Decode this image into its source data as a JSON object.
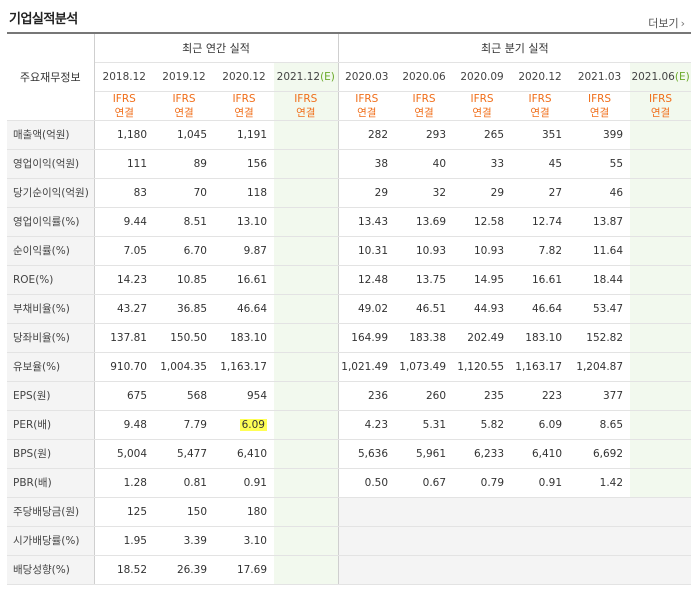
{
  "title": "기업실적분석",
  "more_label": "더보기",
  "header": {
    "row_label": "주요재무정보",
    "annual_group": "최근 연간 실적",
    "quarter_group": "최근 분기 실적"
  },
  "annual_periods": [
    {
      "label": "2018.12",
      "mark": "",
      "std1": "IFRS",
      "std2": "연결"
    },
    {
      "label": "2019.12",
      "mark": "",
      "std1": "IFRS",
      "std2": "연결"
    },
    {
      "label": "2020.12",
      "mark": "",
      "std1": "IFRS",
      "std2": "연결"
    },
    {
      "label": "2021.12",
      "mark": "(E)",
      "std1": "IFRS",
      "std2": "연결"
    }
  ],
  "quarter_periods": [
    {
      "label": "2020.03",
      "mark": "",
      "std1": "IFRS",
      "std2": "연결"
    },
    {
      "label": "2020.06",
      "mark": "",
      "std1": "IFRS",
      "std2": "연결"
    },
    {
      "label": "2020.09",
      "mark": "",
      "std1": "IFRS",
      "std2": "연결"
    },
    {
      "label": "2020.12",
      "mark": "",
      "std1": "IFRS",
      "std2": "연결"
    },
    {
      "label": "2021.03",
      "mark": "",
      "std1": "IFRS",
      "std2": "연결"
    },
    {
      "label": "2021.06",
      "mark": "(E)",
      "std1": "IFRS",
      "std2": "연결"
    }
  ],
  "rows": [
    {
      "label": "매출액(억원)",
      "annual": [
        "1,180",
        "1,045",
        "1,191",
        ""
      ],
      "quarter": [
        "282",
        "293",
        "265",
        "351",
        "399",
        ""
      ]
    },
    {
      "label": "영업이익(억원)",
      "annual": [
        "111",
        "89",
        "156",
        ""
      ],
      "quarter": [
        "38",
        "40",
        "33",
        "45",
        "55",
        ""
      ]
    },
    {
      "label": "당기순이익(억원)",
      "annual": [
        "83",
        "70",
        "118",
        ""
      ],
      "quarter": [
        "29",
        "32",
        "29",
        "27",
        "46",
        ""
      ]
    },
    {
      "label": "영업이익률(%)",
      "annual": [
        "9.44",
        "8.51",
        "13.10",
        ""
      ],
      "quarter": [
        "13.43",
        "13.69",
        "12.58",
        "12.74",
        "13.87",
        ""
      ]
    },
    {
      "label": "순이익률(%)",
      "annual": [
        "7.05",
        "6.70",
        "9.87",
        ""
      ],
      "quarter": [
        "10.31",
        "10.93",
        "10.93",
        "7.82",
        "11.64",
        ""
      ]
    },
    {
      "label": "ROE(%)",
      "annual": [
        "14.23",
        "10.85",
        "16.61",
        ""
      ],
      "quarter": [
        "12.48",
        "13.75",
        "14.95",
        "16.61",
        "18.44",
        ""
      ]
    },
    {
      "label": "부채비율(%)",
      "annual": [
        "43.27",
        "36.85",
        "46.64",
        ""
      ],
      "quarter": [
        "49.02",
        "46.51",
        "44.93",
        "46.64",
        "53.47",
        ""
      ]
    },
    {
      "label": "당좌비율(%)",
      "annual": [
        "137.81",
        "150.50",
        "183.10",
        ""
      ],
      "quarter": [
        "164.99",
        "183.38",
        "202.49",
        "183.10",
        "152.82",
        ""
      ]
    },
    {
      "label": "유보율(%)",
      "annual": [
        "910.70",
        "1,004.35",
        "1,163.17",
        ""
      ],
      "quarter": [
        "1,021.49",
        "1,073.49",
        "1,120.55",
        "1,163.17",
        "1,204.87",
        ""
      ]
    },
    {
      "label": "EPS(원)",
      "annual": [
        "675",
        "568",
        "954",
        ""
      ],
      "quarter": [
        "236",
        "260",
        "235",
        "223",
        "377",
        ""
      ]
    },
    {
      "label": "PER(배)",
      "annual": [
        "9.48",
        "7.79",
        "6.09",
        ""
      ],
      "quarter": [
        "4.23",
        "5.31",
        "5.82",
        "6.09",
        "8.65",
        ""
      ]
    },
    {
      "label": "BPS(원)",
      "annual": [
        "5,004",
        "5,477",
        "6,410",
        ""
      ],
      "quarter": [
        "5,636",
        "5,961",
        "6,233",
        "6,410",
        "6,692",
        ""
      ]
    },
    {
      "label": "PBR(배)",
      "annual": [
        "1.28",
        "0.81",
        "0.91",
        ""
      ],
      "quarter": [
        "0.50",
        "0.67",
        "0.79",
        "0.91",
        "1.42",
        ""
      ]
    },
    {
      "label": "주당배당금(원)",
      "annual": [
        "125",
        "150",
        "180",
        ""
      ],
      "quarter": [
        "",
        "",
        "",
        "",
        "",
        ""
      ]
    },
    {
      "label": "시가배당률(%)",
      "annual": [
        "1.95",
        "3.39",
        "3.10",
        ""
      ],
      "quarter": [
        "",
        "",
        "",
        "",
        "",
        ""
      ]
    },
    {
      "label": "배당성향(%)",
      "annual": [
        "18.52",
        "26.39",
        "17.69",
        ""
      ],
      "quarter": [
        "",
        "",
        "",
        "",
        "",
        ""
      ]
    }
  ],
  "colors": {
    "ifrs": "#f06e1a",
    "estimate_mark": "#6aaa2a",
    "estimate_bg": "#f2f9ee",
    "highlight": "#ffff55"
  }
}
